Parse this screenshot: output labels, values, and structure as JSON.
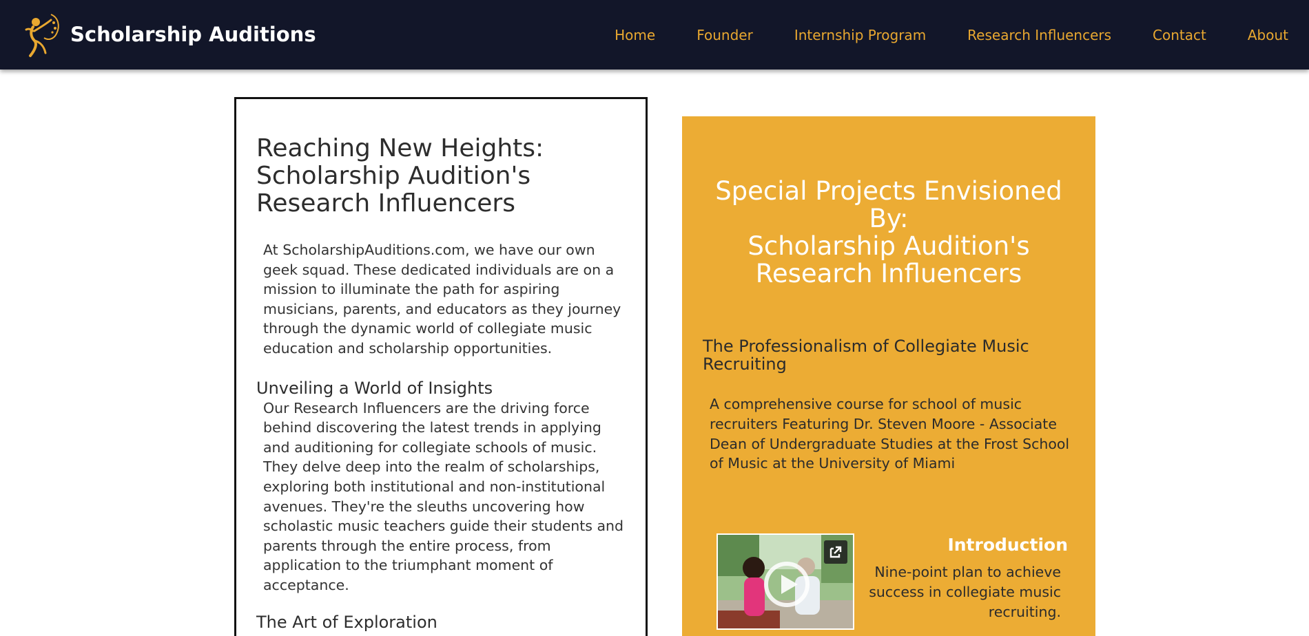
{
  "header": {
    "site_title": "Scholarship Auditions",
    "nav": [
      "Home",
      "Founder",
      "Internship Program",
      "Research Influencers",
      "Contact",
      "About"
    ]
  },
  "article": {
    "title": "Reaching New Heights: Scholarship Audition's Research Influencers",
    "intro": "At ScholarshipAuditions.com, we have our own geek squad. These dedicated individuals are on a mission to illuminate the path for aspiring musicians, parents, and educators as they journey through the dynamic world of collegiate music education and scholarship opportunities.",
    "section1_heading": "Unveiling a World of Insights",
    "section1_text": "Our Research Influencers are the driving force behind discovering the latest trends in applying and auditioning for collegiate schools of music. They delve deep into the realm of scholarships, exploring both institutional and non-institutional avenues. They're the sleuths uncovering how scholastic music teachers guide their students and parents through the entire process, from application to the triumphant moment of acceptance.",
    "section2_heading": "The Art of Exploration"
  },
  "panel": {
    "title_line1": "Special Projects Envisioned By:",
    "title_line2": "Scholarship Audition's Research Influencers",
    "course_title": "The Professionalism of Collegiate Music Recruiting",
    "course_desc": "A comprehensive course for school of music recruiters Featuring Dr. Steven Moore - Associate Dean of Undergraduate Studies at the Frost School of Music at the University of Miami",
    "video": {
      "title": "Introduction",
      "desc": "Nine-point plan to achieve success in collegiate music recruiting."
    }
  },
  "colors": {
    "header_bg": "#121629",
    "nav_link": "#e9a830",
    "panel_bg": "#ecac34"
  },
  "icons": [
    "logo-musician-icon",
    "external-link-icon",
    "play-icon"
  ]
}
